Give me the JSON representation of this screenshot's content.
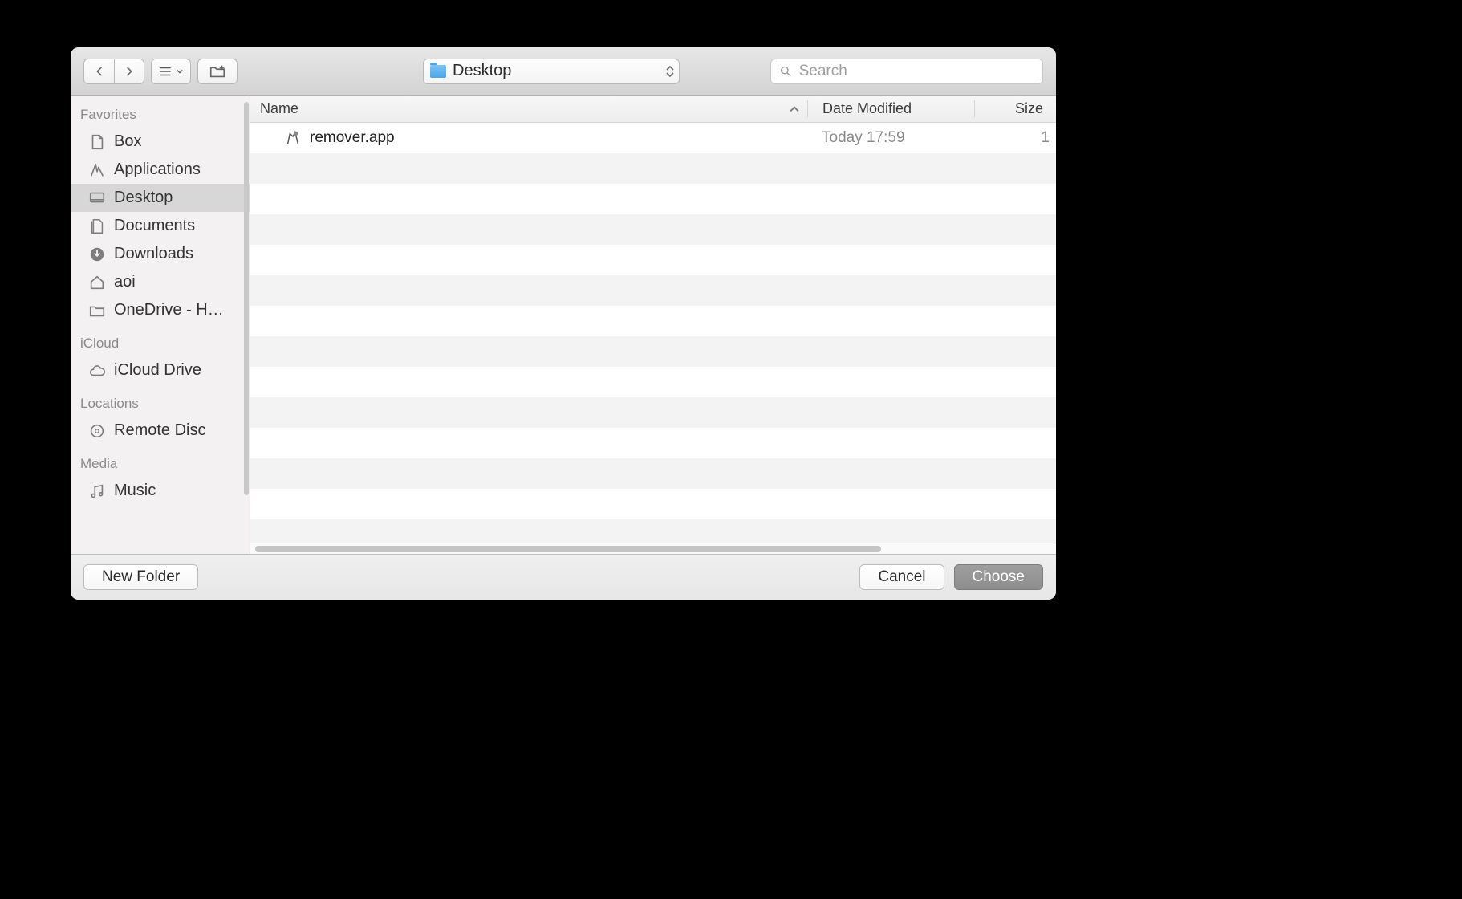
{
  "toolbar": {
    "path_label": "Desktop",
    "search_placeholder": "Search"
  },
  "sidebar": {
    "sections": [
      {
        "title": "Favorites",
        "items": [
          {
            "label": "Box",
            "icon": "doc"
          },
          {
            "label": "Applications",
            "icon": "apps"
          },
          {
            "label": "Desktop",
            "icon": "desktop",
            "selected": true
          },
          {
            "label": "Documents",
            "icon": "docs"
          },
          {
            "label": "Downloads",
            "icon": "downloads"
          },
          {
            "label": "aoi",
            "icon": "home"
          },
          {
            "label": "OneDrive - H…",
            "icon": "folder"
          }
        ]
      },
      {
        "title": "iCloud",
        "items": [
          {
            "label": "iCloud Drive",
            "icon": "cloud"
          }
        ]
      },
      {
        "title": "Locations",
        "items": [
          {
            "label": "Remote Disc",
            "icon": "disc"
          }
        ]
      },
      {
        "title": "Media",
        "items": [
          {
            "label": "Music",
            "icon": "music"
          }
        ]
      }
    ]
  },
  "columns": {
    "name": "Name",
    "date": "Date Modified",
    "size": "Size"
  },
  "files": [
    {
      "name": "remover.app",
      "date": "Today 17:59",
      "size": "1"
    }
  ],
  "footer": {
    "new_folder": "New Folder",
    "cancel": "Cancel",
    "choose": "Choose"
  }
}
